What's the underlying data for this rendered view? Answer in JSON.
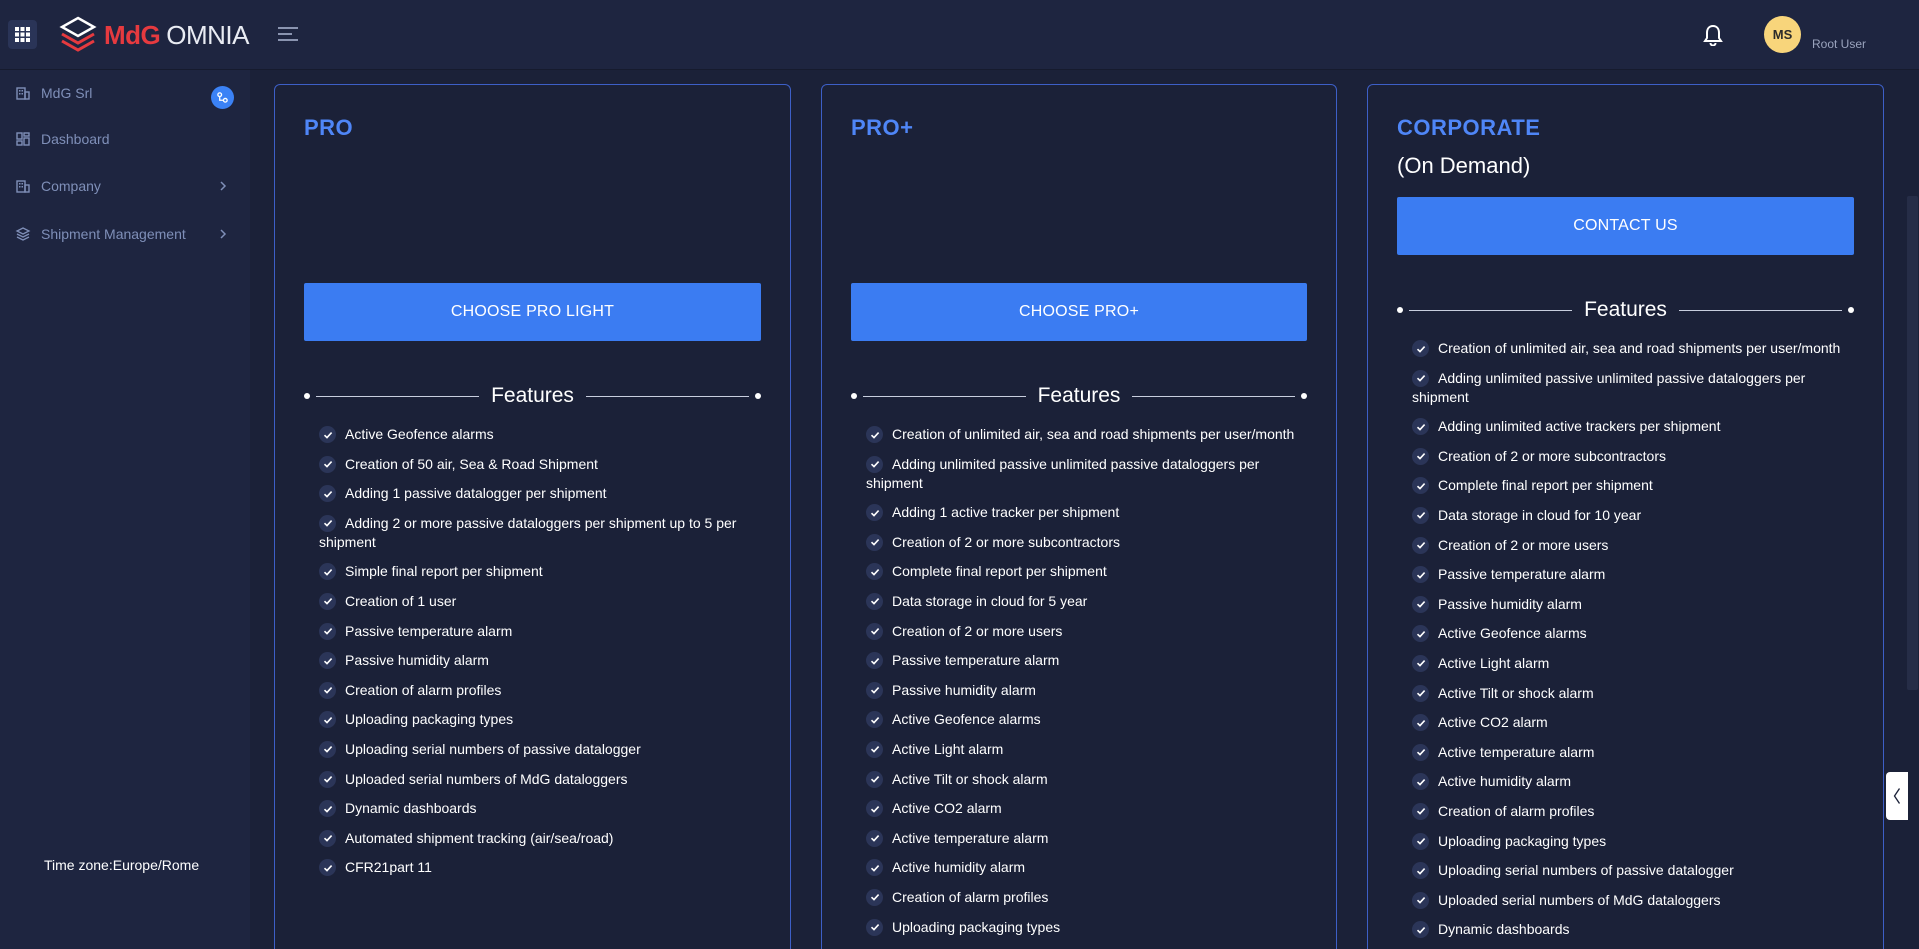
{
  "brand": {
    "name_bold": "MdG",
    "name_light": "OMNIA"
  },
  "header": {
    "avatar_initials": "MS",
    "user_name": "Root User"
  },
  "sidebar": {
    "items": [
      {
        "label": "MdG Srl"
      },
      {
        "label": "Dashboard"
      },
      {
        "label": "Company"
      },
      {
        "label": "Shipment Management"
      }
    ],
    "timezone": "Time zone:Europe/Rome"
  },
  "plans": [
    {
      "title": "PRO",
      "subtitle": "",
      "cta": "CHOOSE PRO LIGHT",
      "features_heading": "Features",
      "features": [
        "Active Geofence alarms",
        "Creation of 50 air, Sea & Road Shipment",
        "Adding 1 passive datalogger per shipment",
        "Adding 2 or more passive dataloggers per shipment up to 5 per shipment",
        "Simple final report per shipment",
        "Creation of 1 user",
        "Passive temperature alarm",
        "Passive humidity alarm",
        "Creation of alarm profiles",
        "Uploading packaging types",
        "Uploading serial numbers of passive datalogger",
        "Uploaded serial numbers of MdG dataloggers",
        "Dynamic dashboards",
        "Automated shipment tracking (air/sea/road)",
        "CFR21part 11"
      ]
    },
    {
      "title": "PRO+",
      "subtitle": "",
      "cta": "CHOOSE PRO+",
      "features_heading": "Features",
      "features": [
        "Creation of unlimited air, sea and road shipments per user/month",
        "Adding unlimited passive unlimited passive dataloggers per shipment",
        "Adding 1 active tracker per shipment",
        "Creation of 2 or more subcontractors",
        "Complete final report per shipment",
        "Data storage in cloud for 5 year",
        "Creation of 2 or more users",
        "Passive temperature alarm",
        "Passive humidity alarm",
        "Active Geofence alarms",
        "Active Light alarm",
        "Active Tilt or shock alarm",
        "Active CO2 alarm",
        "Active temperature alarm",
        "Active humidity alarm",
        "Creation of alarm profiles",
        "Uploading packaging types"
      ]
    },
    {
      "title": "CORPORATE",
      "subtitle": "(On Demand)",
      "cta": "CONTACT US",
      "features_heading": "Features",
      "features": [
        "Creation of unlimited air, sea and road shipments per user/month",
        "Adding unlimited passive unlimited passive dataloggers per shipment",
        "Adding unlimited active trackers per shipment",
        "Creation of 2 or more subcontractors",
        "Complete final report per shipment",
        "Data storage in cloud for 10 year",
        "Creation of 2 or more users",
        "Passive temperature alarm",
        "Passive humidity alarm",
        "Active Geofence alarms",
        "Active Light alarm",
        "Active Tilt or shock alarm",
        "Active CO2 alarm",
        "Active temperature alarm",
        "Active humidity alarm",
        "Creation of alarm profiles",
        "Uploading packaging types",
        "Uploading serial numbers of passive datalogger",
        "Uploaded serial numbers of MdG dataloggers",
        "Dynamic dashboards"
      ]
    }
  ]
}
